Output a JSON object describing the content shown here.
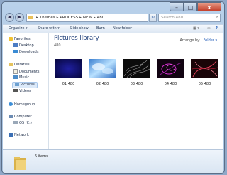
{
  "window": {
    "controls": {
      "minimize": "–",
      "maximize": "□",
      "close": "x"
    }
  },
  "address_bar": {
    "segments": [
      "Themes",
      "PROCESS",
      "NEW",
      "480"
    ],
    "separator": "▸",
    "back_icon": "back-arrow-icon",
    "forward_icon": "forward-arrow-icon"
  },
  "search": {
    "placeholder": "Search 480"
  },
  "toolbar": {
    "organize": "Organize ▾",
    "share_with": "Share with ▾",
    "slide_show": "Slide show",
    "burn": "Burn",
    "new_folder": "New folder"
  },
  "nav": {
    "favorites": "Favorites",
    "desktop": "Desktop",
    "downloads": "Downloads",
    "libraries": "Libraries",
    "documents": "Documents",
    "music": "Music",
    "pictures": "Pictures",
    "videos": "Videos",
    "homegroup": "Homegroup",
    "computer": "Computer",
    "os_c": "OS (C:)",
    "network": "Network"
  },
  "library": {
    "title": "Pictures library",
    "subtitle": "480",
    "arrange_label": "Arrange by:",
    "arrange_value": "Folder ▾"
  },
  "files": [
    {
      "name": "01 480"
    },
    {
      "name": "02 480"
    },
    {
      "name": "03 480"
    },
    {
      "name": "04 480"
    },
    {
      "name": "05 480"
    }
  ],
  "status": {
    "item_count": "5 items"
  },
  "colors": {
    "title_blue": "#1e3e78",
    "selection": "#dbe9f9",
    "link_blue": "#1a56b5"
  }
}
